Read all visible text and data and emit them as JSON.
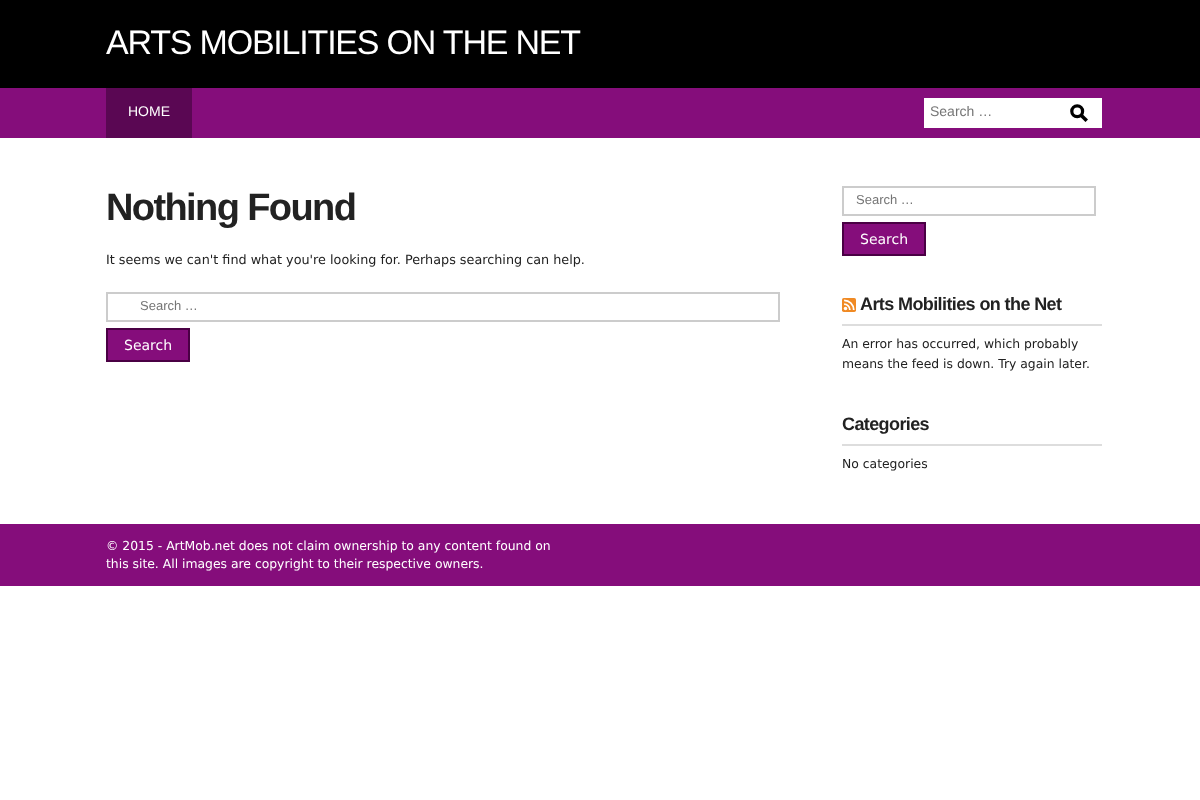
{
  "site_title": "ARTS MOBILITIES ON THE NET",
  "nav": {
    "items": [
      {
        "label": "HOME",
        "selected": true
      }
    ],
    "search": {
      "placeholder": "Search …"
    }
  },
  "main": {
    "title": "Nothing Found",
    "message": "It seems we can't find what you're looking for. Perhaps searching can help.",
    "search": {
      "placeholder": "Search …",
      "button": "Search"
    }
  },
  "sidebar": {
    "search": {
      "placeholder": "Search …",
      "button": "Search"
    },
    "widgets": [
      {
        "kind": "rss",
        "title": "Arts Mobilities on the Net",
        "text": "An error has occurred, which probably means the feed is down. Try again later."
      },
      {
        "kind": "plain",
        "title": "Categories",
        "text": "No categories"
      }
    ]
  },
  "footer": "© 2015 - ArtMob.net does not claim ownership to any content found on this site. All images are copyright to their respective owners."
}
